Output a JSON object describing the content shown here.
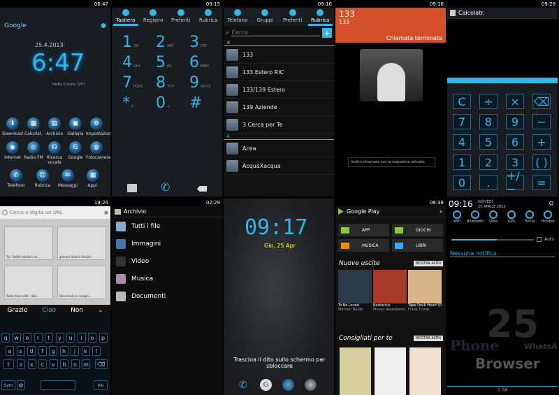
{
  "p1": {
    "status_time": "06:47",
    "search_label": "Google",
    "date": "25.4.2013",
    "clock": "6:47",
    "weather": "Partly Cloudy (19°)",
    "apps": [
      "Download",
      "Calcolat.",
      "Archivio",
      "Galleria",
      "Impostazioni",
      "Internet",
      "Radio FM",
      "Ricerca vocale",
      "Google",
      "Fotocamera",
      "Telefono",
      "Rubrica",
      "Messaggi",
      "Appl."
    ]
  },
  "p2": {
    "status_time": "09:15",
    "tabs": [
      "Tastiera",
      "Registro",
      "Preferiti",
      "Rubrica"
    ],
    "keys": [
      {
        "d": "1",
        "l": "QD"
      },
      {
        "d": "2",
        "l": "ABC"
      },
      {
        "d": "3",
        "l": "DEF"
      },
      {
        "d": "4",
        "l": "GHI"
      },
      {
        "d": "5",
        "l": "JKL"
      },
      {
        "d": "6",
        "l": "MNO"
      },
      {
        "d": "7",
        "l": "PQRS"
      },
      {
        "d": "8",
        "l": "TUV"
      },
      {
        "d": "9",
        "l": "WXYZ"
      },
      {
        "d": "*",
        "l": "P"
      },
      {
        "d": "0",
        "l": "+"
      },
      {
        "d": "#",
        "l": ""
      }
    ]
  },
  "p3": {
    "status_time": "09:16",
    "tabs": [
      "Telefono",
      "Gruppi",
      "Preferiti",
      "Rubrica"
    ],
    "search_placeholder": "Cerca",
    "section1": "#",
    "section2": "A",
    "contacts": [
      "133",
      "133 Estero RIC",
      "133/139 Estero",
      "139 Aziende",
      "3 Cerca per Te",
      "Acea",
      "AcquaXacqua"
    ]
  },
  "p4": {
    "status_time": "09:16",
    "number": "133",
    "sub": "133",
    "call_status": "Chiamata terminata",
    "notice": "Inoltro chiamata con la segreteria attivato"
  },
  "p5": {
    "status_time": "09:29",
    "app_title": "Calcolatr.",
    "keys": [
      "C",
      "÷",
      "×",
      "⌫",
      "7",
      "8",
      "9",
      "−",
      "4",
      "5",
      "6",
      "+",
      "1",
      "2",
      "3",
      "( )",
      "0",
      ".",
      "+/−",
      "="
    ]
  },
  "p6": {
    "status_time": "19:24",
    "url_placeholder": "Cerca o digita un URL",
    "tiles": [
      "Tre. Tariffe telefoni cel...",
      "gchrom Search Results",
      "Stato Xbox LIVE - Sba...",
      "Benvenuto in Google..."
    ],
    "suggestions": [
      "Grazie",
      "Ciao",
      "Non"
    ],
    "rows": [
      [
        "q",
        "w",
        "e",
        "r",
        "t",
        "y",
        "u",
        "i",
        "o",
        "p"
      ],
      [
        "a",
        "s",
        "d",
        "f",
        "g",
        "h",
        "j",
        "k",
        "l"
      ],
      [
        "z",
        "x",
        "c",
        "v",
        "b",
        "n",
        "m"
      ]
    ],
    "sym": "Sym",
    "go": "Vai"
  },
  "p7": {
    "status_time": "02:29",
    "title": "Archivio",
    "items": [
      "Tutti i file",
      "Immagini",
      "Video",
      "Musica",
      "Documenti"
    ]
  },
  "p8": {
    "clock": "09:17",
    "date": "Gio, 25 Apr",
    "hint": "Trascina il dito sullo schermo per sbloccare"
  },
  "p9": {
    "status_time": "08:38",
    "title": "Google Play",
    "cats": [
      "APP",
      "GIOCHI",
      "MUSICA",
      "LIBRI"
    ],
    "new_section": "Nuove uscite",
    "more": "MOSTRA ALTRI",
    "rec_section": "Consigliati per te",
    "albums": [
      {
        "title": "To Be Loved",
        "artist": "Michael Bublé"
      },
      {
        "title": "Barbarica",
        "artist": "Museo Rosenbach"
      },
      {
        "title": "Tape Deck Heart (Deluxe",
        "artist": "Frank Turner"
      }
    ]
  },
  "p10": {
    "time": "09:16",
    "day": "GIOVEDÌ",
    "date": "25 APRILE 2013",
    "toggles": [
      "WiFi",
      "Bluetooth",
      "Vibro",
      "GPS",
      "Torcia",
      "Hotspot"
    ],
    "auto": "Auto",
    "no_notif": "Nessuna notifica",
    "carrier": "3 ITA",
    "bg_words": [
      "25",
      "Phone",
      "WhatsA",
      "Browser"
    ]
  }
}
